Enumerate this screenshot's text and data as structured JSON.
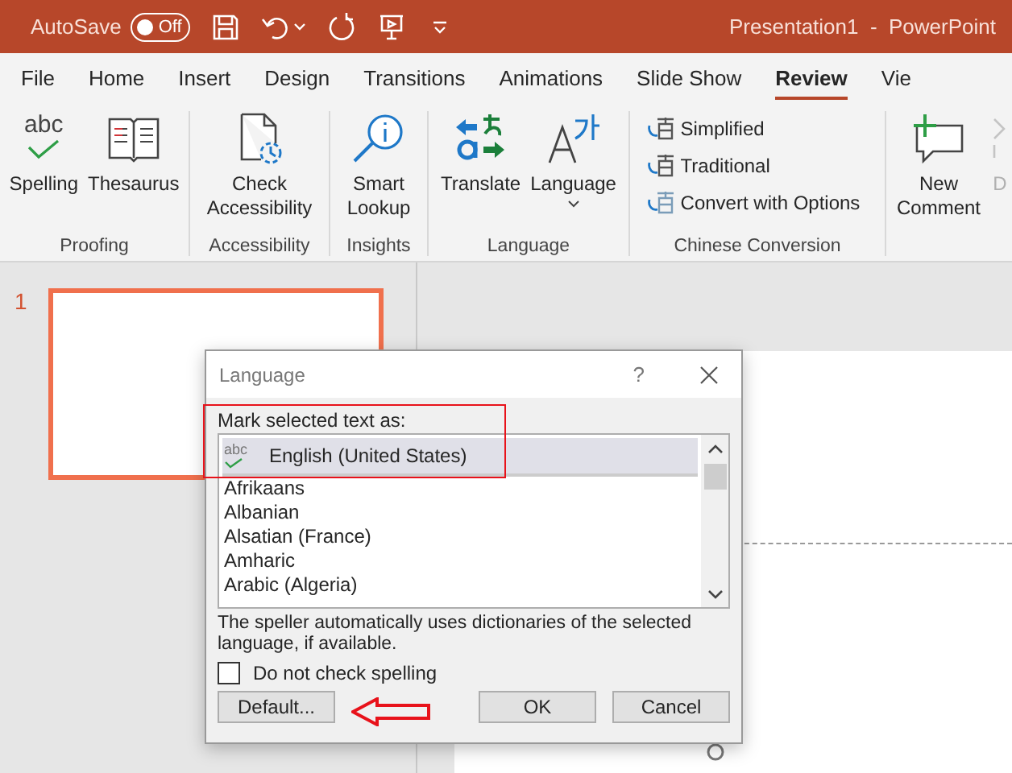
{
  "title_bar": {
    "autosave_label": "AutoSave",
    "autosave": {
      "on": false,
      "label": "Off"
    },
    "document_title": "Presentation1  -  PowerPoint"
  },
  "tabs": [
    {
      "label": "File",
      "selected": false
    },
    {
      "label": "Home",
      "selected": false
    },
    {
      "label": "Insert",
      "selected": false
    },
    {
      "label": "Design",
      "selected": false
    },
    {
      "label": "Transitions",
      "selected": false
    },
    {
      "label": "Animations",
      "selected": false
    },
    {
      "label": "Slide Show",
      "selected": false
    },
    {
      "label": "Review",
      "selected": true
    },
    {
      "label": "Vie",
      "selected": false
    }
  ],
  "ribbon": {
    "groups": [
      {
        "label": "Proofing",
        "buttons": [
          {
            "label": "Spelling",
            "glyph": "abc"
          },
          {
            "label": "Thesaurus"
          }
        ]
      },
      {
        "label": "Accessibility",
        "buttons": [
          {
            "label": "Check Accessibility"
          }
        ]
      },
      {
        "label": "Insights",
        "buttons": [
          {
            "label": "Smart Lookup"
          }
        ]
      },
      {
        "label": "Language",
        "buttons": [
          {
            "label": "Translate"
          },
          {
            "label": "Language",
            "dropdown": true
          }
        ]
      },
      {
        "label": "Chinese Conversion",
        "small": true,
        "buttons": [
          {
            "label": "Simplified"
          },
          {
            "label": "Traditional"
          },
          {
            "label": "Convert with Options"
          }
        ]
      },
      {
        "buttons": [
          {
            "label": "New Comment",
            "disabled": false
          },
          {
            "label": "D",
            "disabled": true
          }
        ]
      }
    ]
  },
  "slides": [
    {
      "number": "1",
      "selected": true
    }
  ],
  "dialog": {
    "title": "Language",
    "help": "?",
    "prompt": "Mark selected text as:",
    "proofing_glyph": "abc",
    "languages": [
      {
        "name": "English (United States)",
        "selected": true,
        "proofing": true
      },
      {
        "name": "Afrikaans",
        "selected": false,
        "proofing": false
      },
      {
        "name": "Albanian",
        "selected": false,
        "proofing": false
      },
      {
        "name": "Alsatian (France)",
        "selected": false,
        "proofing": false
      },
      {
        "name": "Amharic",
        "selected": false,
        "proofing": false
      },
      {
        "name": "Arabic (Algeria)",
        "selected": false,
        "proofing": false
      }
    ],
    "note": "The speller automatically uses dictionaries of the selected language, if available.",
    "do_not_check": {
      "label": "Do not check spelling",
      "checked": false
    },
    "buttons": [
      "Default...",
      "OK",
      "Cancel"
    ]
  }
}
